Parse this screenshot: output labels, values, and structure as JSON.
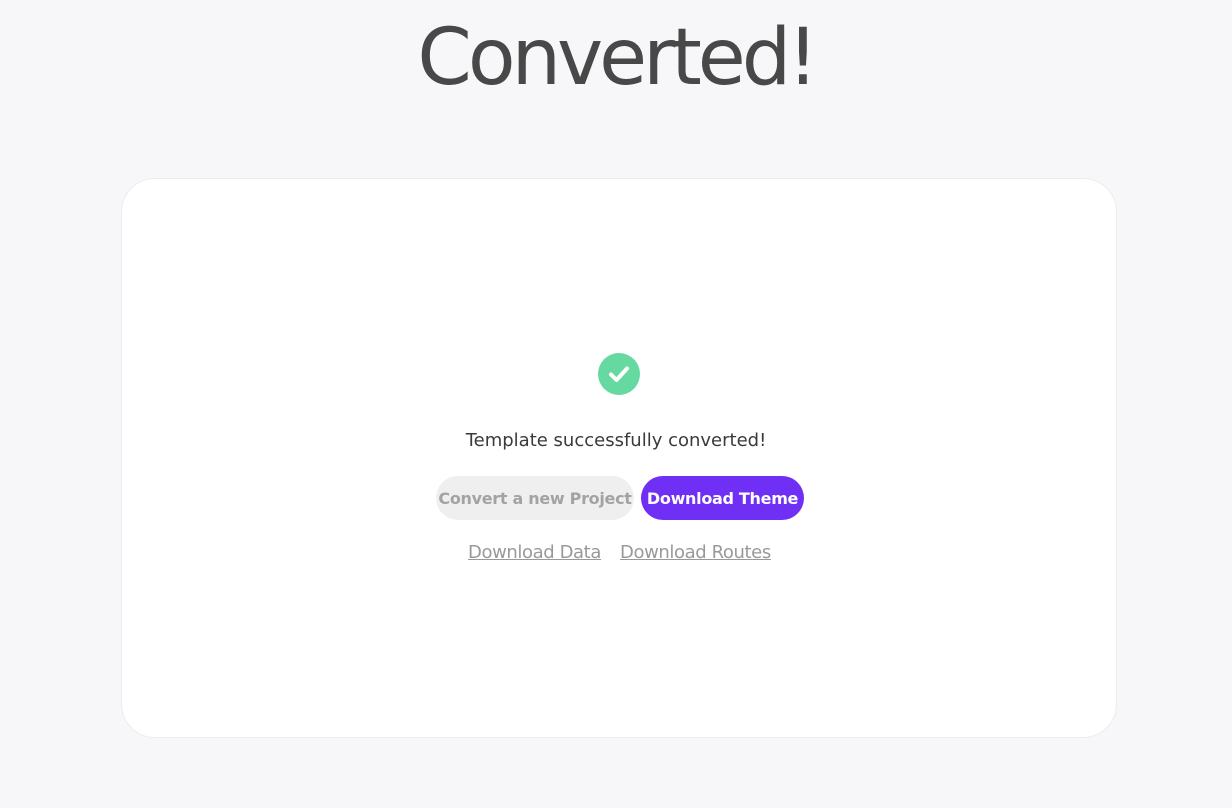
{
  "page": {
    "title": "Converted!"
  },
  "status": {
    "icon": "check-circle-icon",
    "message": "Template successfully converted!"
  },
  "actions": {
    "convert_new_label": "Convert a new Project",
    "download_theme_label": "Download Theme",
    "download_data_label": "Download Data",
    "download_routes_label": "Download Routes"
  },
  "colors": {
    "accent": "#6f2ff5",
    "success": "#66d9a0",
    "background": "#f7f7f9"
  }
}
